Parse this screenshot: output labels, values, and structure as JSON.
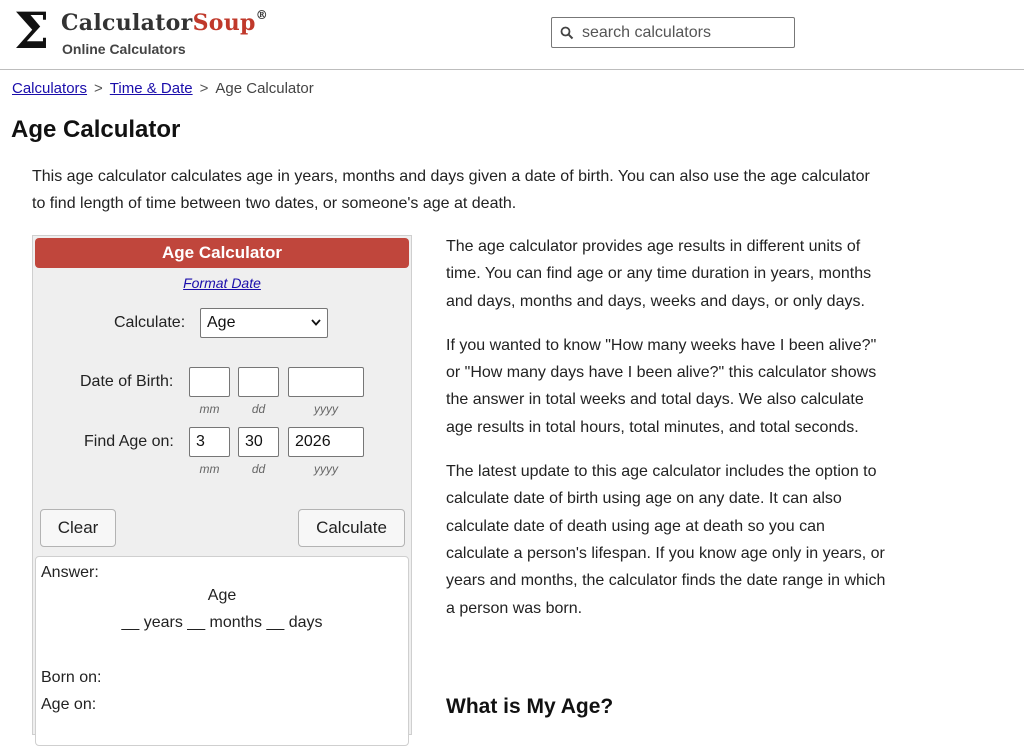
{
  "header": {
    "logo_symbol": "Σ",
    "logo_calculator": "Calculator",
    "logo_soup": "Soup",
    "logo_registered": "®",
    "logo_subtitle": "Online Calculators",
    "search_placeholder": "search calculators"
  },
  "breadcrumb": {
    "items": [
      "Calculators",
      "Time & Date",
      "Age Calculator"
    ],
    "separator": ">"
  },
  "page_title": "Age Calculator",
  "intro": "This age calculator calculates age in years, months and days given a date of birth. You can also use the age calculator to find length of time between two dates, or someone's age at death.",
  "calculator": {
    "title": "Age Calculator",
    "format_link": "Format Date",
    "calculate_label": "Calculate:",
    "calculate_selected": "Age",
    "dob_label": "Date of Birth:",
    "dob": {
      "mm": "",
      "dd": "",
      "yyyy": ""
    },
    "find_age_label": "Find Age on:",
    "find_age": {
      "mm": "3",
      "dd": "30",
      "yyyy": "2026"
    },
    "hint_mm": "mm",
    "hint_dd": "dd",
    "hint_yyyy": "yyyy",
    "clear_label": "Clear",
    "calculate_button": "Calculate",
    "answer_label": "Answer:",
    "answer_heading": "Age",
    "answer_line": "__ years __ months __ days",
    "born_on_label": "Born on:",
    "age_on_label": "Age on:"
  },
  "right_column": {
    "paragraphs": [
      "The age calculator provides age results in different units of time. You can find age or any time duration in years, months and days, months and days, weeks and days, or only days.",
      "If you wanted to know \"How many weeks have I been alive?\" or \"How many days have I been alive?\" this calculator shows the answer in total weeks and total days. We also calculate age results in total hours, total minutes, and total seconds.",
      "The latest update to this age calculator includes the option to calculate date of birth using age on any date. It can also calculate date of death using age at death so you can calculate a person's lifespan. If you know age only in years, or years and months, the calculator finds the date range in which a person was born."
    ],
    "heading": "What is My Age?"
  },
  "colors": {
    "brand_red": "#c0463c",
    "link_blue": "#1a0dab"
  }
}
